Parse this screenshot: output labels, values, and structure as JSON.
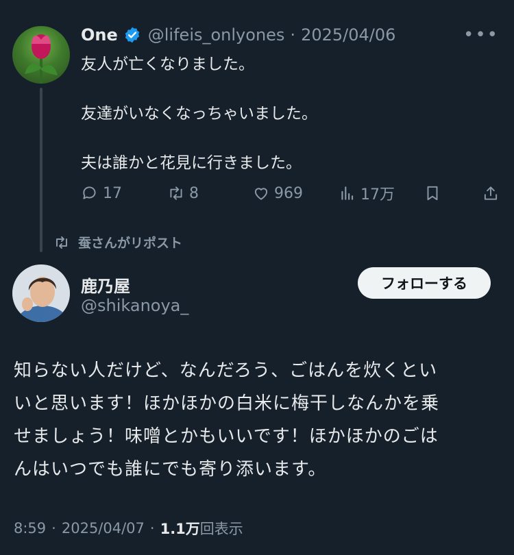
{
  "parent_tweet": {
    "display_name": "One",
    "handle": "@lifeis_onlyones",
    "separator": "·",
    "date": "2025/04/06",
    "more_label": "•••",
    "lines": [
      "友人が亡くなりました。",
      "友達がいなくなっちゃいました。",
      "夫は誰かと花見に行きました。"
    ],
    "actions": {
      "reply": "17",
      "retweet": "8",
      "like": "969",
      "views": "17万"
    }
  },
  "repost_notice": "蚕さんがリポスト",
  "main_tweet": {
    "display_name": "鹿乃屋",
    "handle": "@shikanoya_",
    "follow_label": "フォローする",
    "lines": [
      "知らない人だけど、なんだろう、ごはんを炊くとい",
      "いと思います！ほかほかの白米に梅干しなんかを乗",
      "せましょう！味噌とかもいいです！ほかほかのごは",
      "んはいつでも誰にでも寄り添います。"
    ],
    "time": "8:59",
    "separator": "·",
    "date": "2025/04/07",
    "separator2": "·",
    "views_count": "1.1万",
    "views_label": "回表示"
  },
  "colors": {
    "background": "#15202b",
    "text": "#e7e9ea",
    "muted": "#8b98a5",
    "verified": "#1d9bf0"
  }
}
